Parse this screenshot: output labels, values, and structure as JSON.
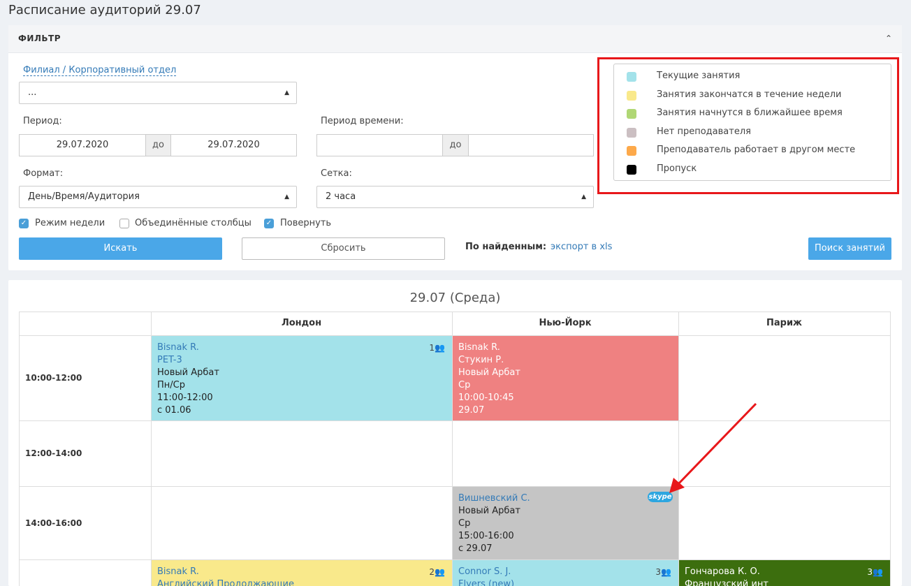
{
  "page_title": "Расписание аудиторий 29.07",
  "filter": {
    "title": "ФИЛЬТР",
    "branch_link": "Филиал / Корпоративный отдел",
    "branch_value": "...",
    "period_label": "Период:",
    "period_from": "29.07.2020",
    "period_sep": "до",
    "period_to": "29.07.2020",
    "time_period_label": "Период времени:",
    "time_from": "",
    "time_sep": "до",
    "time_to": "",
    "format_label": "Формат:",
    "format_value": "День/Время/Аудитория",
    "grid_label": "Сетка:",
    "grid_value": "2 часа",
    "cb_week": "Режим недели",
    "cb_merged": "Объединённые столбцы",
    "cb_rotate": "Повернуть",
    "search_btn": "Искать",
    "reset_btn": "Сбросить",
    "found_label": "По найденным:",
    "export_link": "экспорт в xls",
    "search_lessons_btn": "Поиск занятий"
  },
  "legend": [
    {
      "color": "#a3e2ea",
      "text": "Текущие занятия"
    },
    {
      "color": "#f9e98b",
      "text": "Занятия закончатся в течение недели"
    },
    {
      "color": "#b0d775",
      "text": "Занятия начнутся в ближайшее время"
    },
    {
      "color": "#cbbfc2",
      "text": "Нет преподавателя"
    },
    {
      "color": "#fda94a",
      "text": "Преподаватель работает в другом месте"
    },
    {
      "color": "#000000",
      "text": "Пропуск"
    }
  ],
  "schedule": {
    "title": "29.07 (Среда)",
    "columns": [
      "Лондон",
      "Нью-Йорк",
      "Париж"
    ],
    "times": [
      "10:00-12:00",
      "12:00-14:00",
      "14:00-16:00",
      ""
    ],
    "cells": {
      "london_1": {
        "teacher": "Bisnak R.",
        "group": "PET-3",
        "place": "Новый Арбат",
        "days": "Пн/Ср",
        "time": "11:00-12:00",
        "since": "с 01.06",
        "count": "1"
      },
      "ny_1": {
        "teacher": "Bisnak R.",
        "group": "Стукин Р.",
        "place": "Новый Арбат",
        "days": "Ср",
        "time": "10:00-10:45",
        "since": "29.07"
      },
      "ny_3": {
        "teacher": "Вишневский С.",
        "place": "Новый Арбат",
        "days": "Ср",
        "time": "15:00-16:00",
        "since": "с 29.07",
        "icon": "skype"
      },
      "london_4": {
        "teacher": "Bisnak R.",
        "group": "Английский Продолжающие",
        "count": "2"
      },
      "ny_4": {
        "teacher": "Connor S. J.",
        "group": "Flyers (new)",
        "count": "3"
      },
      "paris_4": {
        "teacher": "Гончарова К. О.",
        "group": "Французский инт",
        "count": "3"
      }
    }
  },
  "colors": {
    "current": "#a3e2ea",
    "ending": "#f9e98b",
    "missing_teacher_red": "#ef8181",
    "gray": "#c5c5c5",
    "dark_green": "#3c6e0e",
    "primary": "#4aa7e8",
    "highlight_red": "#e8171a"
  }
}
